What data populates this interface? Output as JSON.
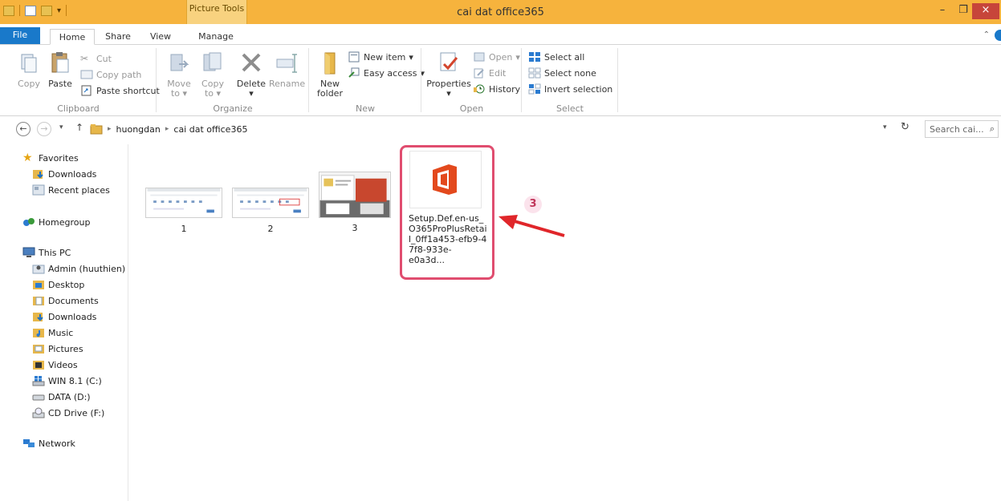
{
  "window": {
    "context_tab": "Picture Tools",
    "title": "cai dat office365",
    "minimize": "–",
    "restore": "❐",
    "close": "×"
  },
  "tabs": {
    "file": "File",
    "home": "Home",
    "share": "Share",
    "view": "View",
    "manage": "Manage"
  },
  "ribbon": {
    "clipboard": {
      "copy": "Copy",
      "paste": "Paste",
      "cut": "Cut",
      "copy_path": "Copy path",
      "paste_shortcut": "Paste shortcut",
      "label": "Clipboard"
    },
    "organize": {
      "move_to": "Move",
      "move_to_2": "to",
      "copy_to": "Copy",
      "copy_to_2": "to",
      "delete": "Delete",
      "rename": "Rename",
      "label": "Organize"
    },
    "new": {
      "new_folder": "New",
      "new_folder_2": "folder",
      "new_item": "New item",
      "easy_access": "Easy access",
      "label": "New"
    },
    "open": {
      "properties": "Properties",
      "open": "Open",
      "edit": "Edit",
      "history": "History",
      "label": "Open"
    },
    "select": {
      "select_all": "Select all",
      "select_none": "Select none",
      "invert_selection": "Invert selection",
      "label": "Select"
    }
  },
  "address": {
    "crumbs": [
      "huongdan",
      "cai dat office365"
    ],
    "search_placeholder": "Search cai..."
  },
  "navpane": {
    "favorites": "Favorites",
    "downloads": "Downloads",
    "recent_places": "Recent places",
    "homegroup": "Homegroup",
    "this_pc": "This PC",
    "admin": "Admin (huuthien)",
    "desktop": "Desktop",
    "documents": "Documents",
    "downloads2": "Downloads",
    "music": "Music",
    "pictures": "Pictures",
    "videos": "Videos",
    "win81": "WIN 8.1 (C:)",
    "data": "DATA (D:)",
    "cd": "CD Drive (F:)",
    "network": "Network"
  },
  "files": [
    {
      "name": "1"
    },
    {
      "name": "2"
    },
    {
      "name": "3"
    },
    {
      "name_lines": [
        "Setup.Def.en-us_",
        "O365ProPlusRetai",
        "l_0ff1a453-efb9-4",
        "7f8-933e-e0a3d..."
      ]
    }
  ],
  "annotation": {
    "number": "3"
  }
}
